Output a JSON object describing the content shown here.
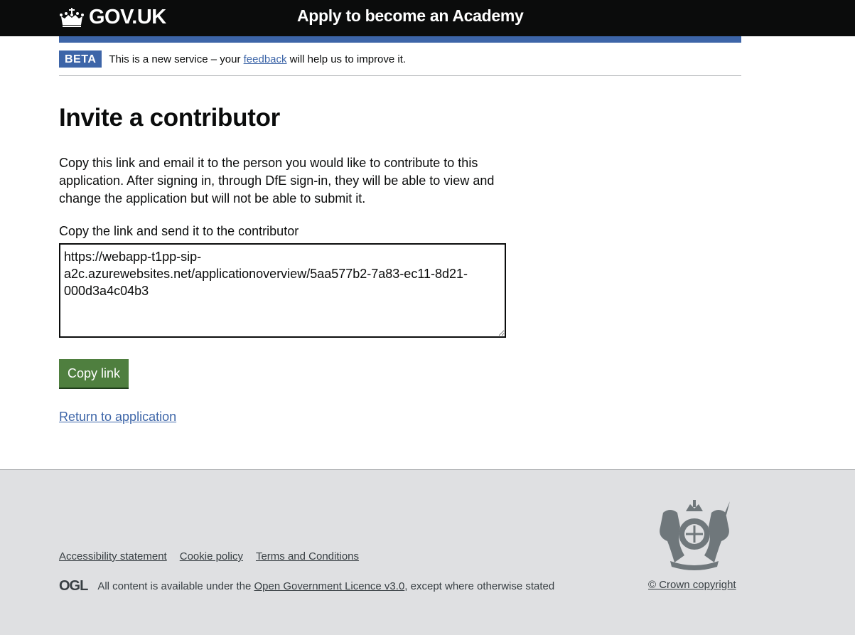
{
  "header": {
    "logo_text": "GOV.UK",
    "logo_icon": "crown-icon",
    "service_name": "Apply to become an Academy"
  },
  "phase_banner": {
    "tag": "BETA",
    "text_before": "This is a new service – your ",
    "link_text": "feedback",
    "text_after": " will help us to improve it."
  },
  "main": {
    "title": "Invite a contributor",
    "intro": "Copy this link and email it to the person you would like to contribute to this application. After signing in, through DfE sign-in, they will be able to view and change the application but will not be able to submit it.",
    "link_label": "Copy the link and send it to the contributor",
    "link_value": "https://webapp-t1pp-sip-a2c.azurewebsites.net/applicationoverview/5aa577b2-7a83-ec11-8d21-000d3a4c04b3",
    "copy_button": "Copy link",
    "return_link": "Return to application"
  },
  "footer": {
    "links": [
      "Accessibility statement",
      "Cookie policy",
      "Terms and Conditions"
    ],
    "ogl_logo": "OGL",
    "licence_before": "All content is available under the ",
    "licence_link": "Open Government Licence v3.0",
    "licence_after": ", except where otherwise stated",
    "crest_icon": "royal-coat-of-arms-icon",
    "copyright": "© Crown copyright"
  },
  "colors": {
    "header_bg": "#0b0c0c",
    "brand_blue": "#3d65a8",
    "button_green": "#4f7f3f",
    "footer_bg": "#dfe0e2"
  }
}
